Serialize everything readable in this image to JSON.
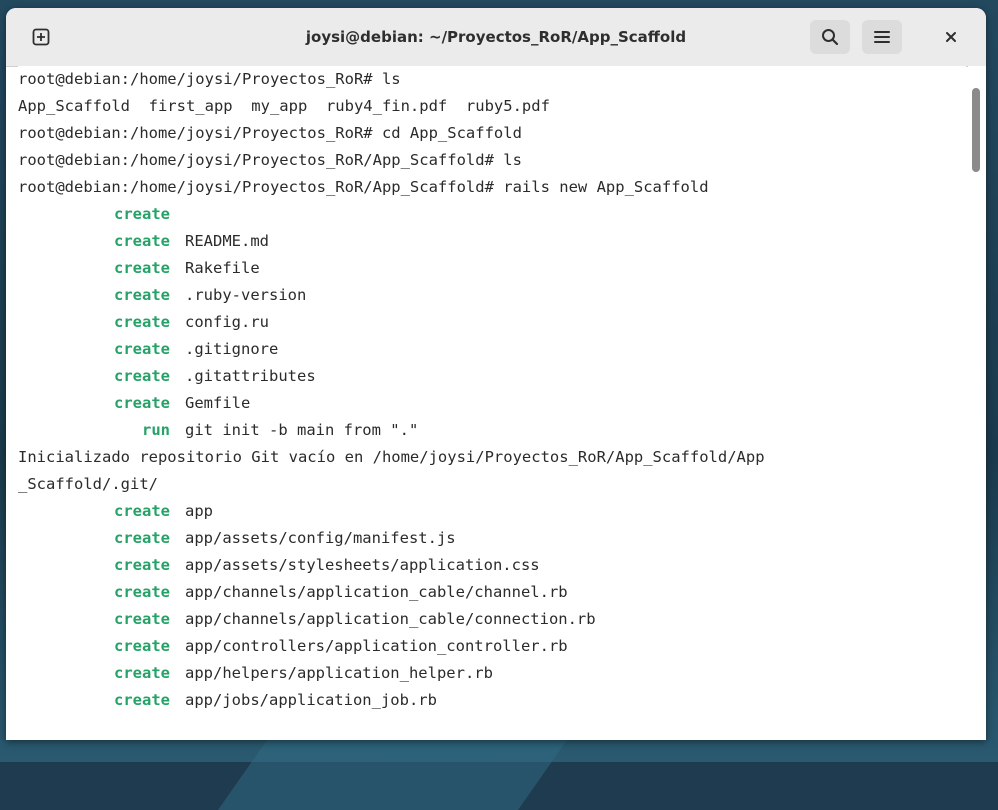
{
  "window": {
    "title": "joysi@debian: ~/Proyectos_RoR/App_Scaffold"
  },
  "icons": {
    "new_tab": "new-tab-plus-icon",
    "search": "search-icon",
    "menu": "hamburger-menu-icon",
    "close": "close-icon"
  },
  "colors": {
    "keyword_green": "#26a269",
    "text": "#2b2b2b",
    "headerbar": "#ebebeb"
  },
  "terminal": {
    "lines": [
      {
        "text": "root@debian:/home/joysi/Proyectos_RoR# ls"
      },
      {
        "text": "App_Scaffold  first_app  my_app  ruby4_fin.pdf  ruby5.pdf"
      },
      {
        "text": "root@debian:/home/joysi/Proyectos_RoR# cd App_Scaffold"
      },
      {
        "text": "root@debian:/home/joysi/Proyectos_RoR/App_Scaffold# ls"
      },
      {
        "text": "root@debian:/home/joysi/Proyectos_RoR/App_Scaffold# rails new App_Scaffold"
      },
      {
        "kw": "create",
        "text": ""
      },
      {
        "kw": "create",
        "text": "README.md"
      },
      {
        "kw": "create",
        "text": "Rakefile"
      },
      {
        "kw": "create",
        "text": ".ruby-version"
      },
      {
        "kw": "create",
        "text": "config.ru"
      },
      {
        "kw": "create",
        "text": ".gitignore"
      },
      {
        "kw": "create",
        "text": ".gitattributes"
      },
      {
        "kw": "create",
        "text": "Gemfile"
      },
      {
        "kw": "run",
        "text": "git init -b main from \".\""
      },
      {
        "text": "Inicializado repositorio Git vacío en /home/joysi/Proyectos_RoR/App_Scaffold/App"
      },
      {
        "text": "_Scaffold/.git/"
      },
      {
        "kw": "create",
        "text": "app"
      },
      {
        "kw": "create",
        "text": "app/assets/config/manifest.js"
      },
      {
        "kw": "create",
        "text": "app/assets/stylesheets/application.css"
      },
      {
        "kw": "create",
        "text": "app/channels/application_cable/channel.rb"
      },
      {
        "kw": "create",
        "text": "app/channels/application_cable/connection.rb"
      },
      {
        "kw": "create",
        "text": "app/controllers/application_controller.rb"
      },
      {
        "kw": "create",
        "text": "app/helpers/application_helper.rb"
      },
      {
        "kw": "create",
        "text": "app/jobs/application_job.rb"
      }
    ]
  }
}
